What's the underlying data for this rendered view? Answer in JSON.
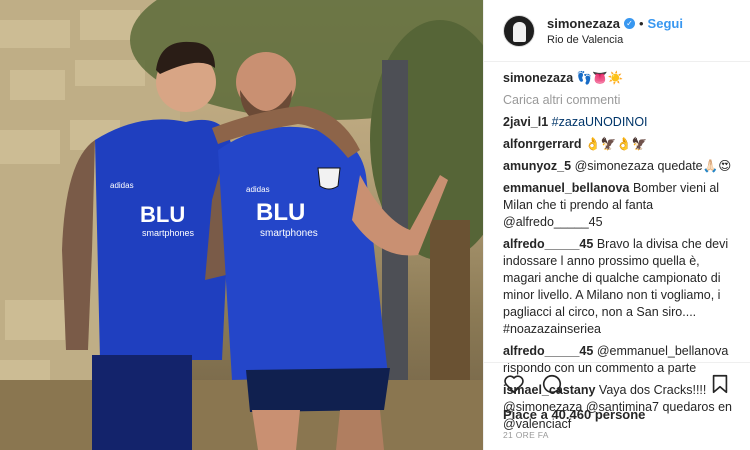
{
  "header": {
    "username": "simonezaza",
    "follow_label": "Segui",
    "location": "Rio de Valencia"
  },
  "caption": {
    "username": "simonezaza",
    "text": "👣👅☀️"
  },
  "load_more_label": "Carica altri commenti",
  "comments": [
    {
      "user": "2javi_l1",
      "text": "#zazaUNODINOI"
    },
    {
      "user": "alfonrgerrard",
      "text": "👌🦅👌🦅"
    },
    {
      "user": "amunyoz_5",
      "text": "@simonezaza quedate🙏🏻😍"
    },
    {
      "user": "emmanuel_bellanova",
      "text": "Bomber vieni al Milan che ti prendo al fanta @alfredo_____45"
    },
    {
      "user": "alfredo_____45",
      "text": "Bravo la divisa che devi indossare l anno prossimo quella è, magari anche di qualche campionato di minor livello. A Milano non ti vogliamo, i pagliacci al circo, non a San siro.... #noazazainseriea"
    },
    {
      "user": "alfredo_____45",
      "text": "@emmanuel_bellanova rispondo con un commento a parte"
    },
    {
      "user": "ismael_castany",
      "text": "Vaya dos Cracks!!!! @simonezaza @santimina7 quedaros en @valenciacf"
    }
  ],
  "likes": {
    "prefix": "Piace a",
    "count": "40.460",
    "suffix": "persone"
  },
  "timestamp": "21 ORE FA",
  "photo": {
    "shirt_text_1": "BLU",
    "shirt_text_2": "smartphones",
    "kit_brand": "adidas"
  },
  "icons": [
    "heart-icon",
    "comment-icon",
    "bookmark-icon",
    "verified-icon"
  ],
  "colors": {
    "link": "#003569",
    "follow": "#3897f0",
    "kit_blue": "#1f3fbf"
  }
}
